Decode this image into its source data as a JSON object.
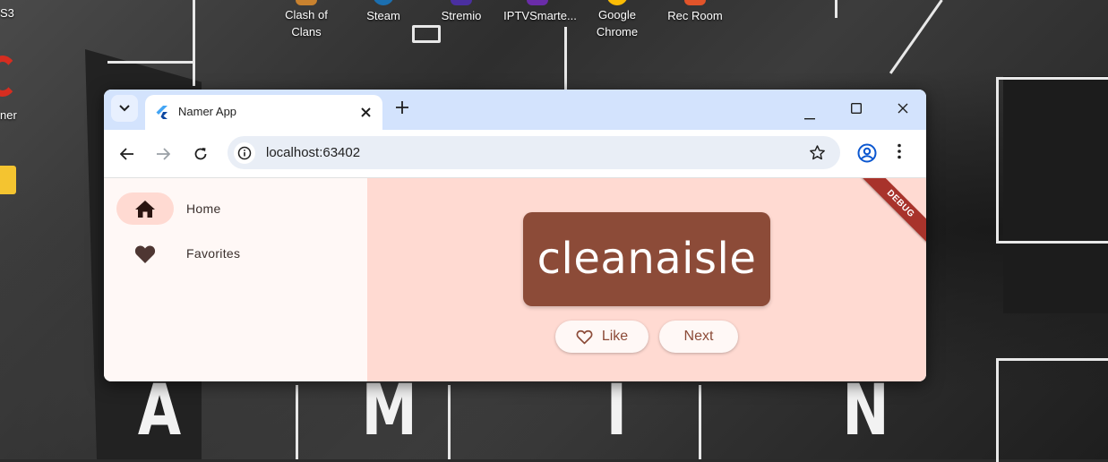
{
  "desktop": {
    "icons": [
      {
        "label": "Clash of\nClans"
      },
      {
        "label": "Steam"
      },
      {
        "label": "Stremio"
      },
      {
        "label": "IPTVSmarte..."
      },
      {
        "label": "Google\nChrome"
      },
      {
        "label": "Rec Room"
      }
    ],
    "partial_left_labels": [
      "S3",
      "ner"
    ],
    "wallpaper_letters": [
      "A",
      "M",
      "I",
      "N"
    ]
  },
  "browser": {
    "tab": {
      "title": "Namer App",
      "favicon": "flutter-logo-icon"
    },
    "url": "localhost:63402",
    "window_controls": [
      "minimize-icon",
      "maximize-icon",
      "close-icon"
    ]
  },
  "app": {
    "nav": [
      {
        "label": "Home",
        "icon": "home-icon",
        "active": true
      },
      {
        "label": "Favorites",
        "icon": "heart-icon",
        "active": false
      }
    ],
    "word": "cleanaisle",
    "like_label": "Like",
    "next_label": "Next",
    "debug_banner": "DEBUG"
  },
  "colors": {
    "accent": "#8c4b38",
    "main_bg": "#ffdad2",
    "rail_bg": "#fff8f6",
    "tabbar_bg": "#d3e3fd"
  }
}
